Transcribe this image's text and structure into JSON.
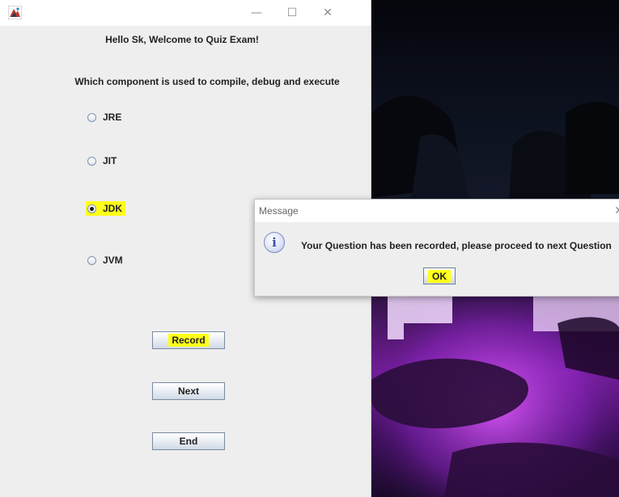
{
  "window": {
    "minimize_glyph": "—",
    "maximize_glyph": "☐",
    "close_glyph": "✕"
  },
  "quiz": {
    "welcome": "Hello Sk, Welcome to Quiz Exam!",
    "question": "Which component is used to compile, debug and execute",
    "options": [
      {
        "label": "JRE",
        "selected": false
      },
      {
        "label": "JIT",
        "selected": false
      },
      {
        "label": "JDK",
        "selected": true
      },
      {
        "label": "JVM",
        "selected": false
      }
    ],
    "buttons": {
      "record": "Record",
      "next": "Next",
      "end": "End"
    }
  },
  "dialog": {
    "title": "Message",
    "close_glyph": "✕",
    "icon": "information-icon",
    "icon_glyph": "i",
    "message": "Your Question has been recorded,  please proceed to next Question",
    "ok": "OK"
  },
  "colors": {
    "highlight": "#ffff1a",
    "window_bg": "#eeeeee"
  }
}
